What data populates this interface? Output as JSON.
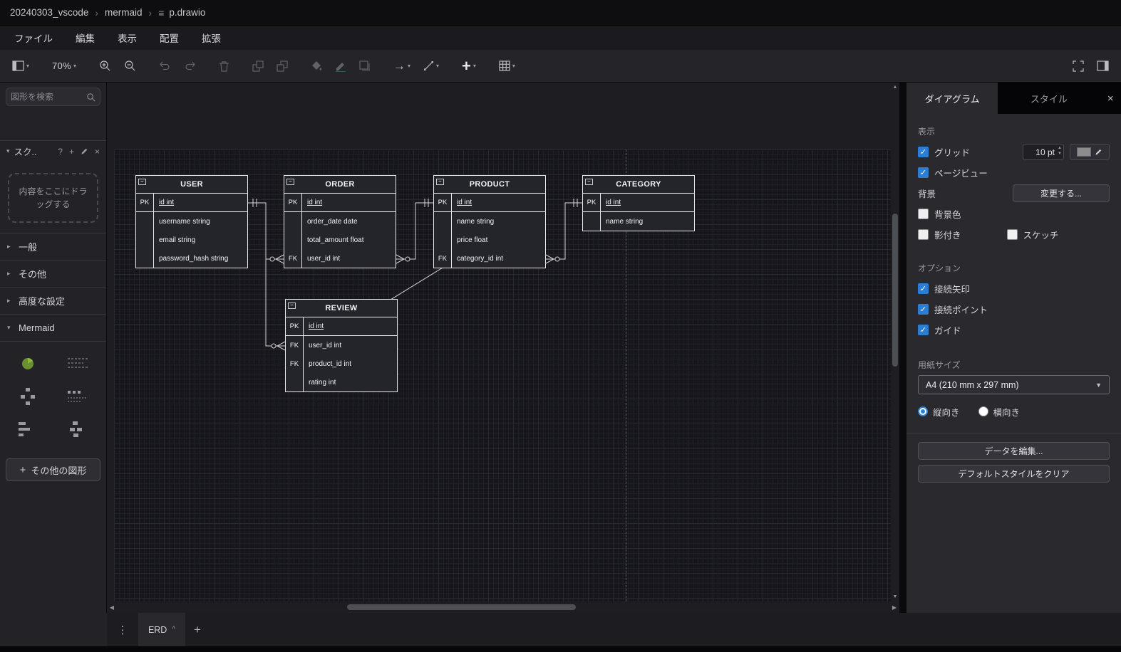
{
  "window": {
    "breadcrumb": [
      "20240303_vscode",
      "mermaid",
      "p.drawio"
    ]
  },
  "menu": {
    "items": [
      "ファイル",
      "編集",
      "表示",
      "配置",
      "拡張"
    ]
  },
  "toolbar": {
    "zoom": "70%"
  },
  "sidebar": {
    "search_placeholder": "図形を検索",
    "scratchpad": {
      "title": "スク.."
    },
    "drop_hint": "内容をここにドラッグする",
    "sections": [
      {
        "label": "一般"
      },
      {
        "label": "その他"
      },
      {
        "label": "高度な設定"
      },
      {
        "label": "Mermaid"
      }
    ],
    "more_shapes": "その他の図形"
  },
  "canvas": {
    "entities": [
      {
        "name": "USER",
        "rows": [
          {
            "k": "PK",
            "f": "id int"
          },
          {
            "k": "",
            "f": "username string"
          },
          {
            "k": "",
            "f": "email string"
          },
          {
            "k": "",
            "f": "password_hash string"
          }
        ]
      },
      {
        "name": "ORDER",
        "rows": [
          {
            "k": "PK",
            "f": "id int"
          },
          {
            "k": "",
            "f": "order_date date"
          },
          {
            "k": "",
            "f": "total_amount float"
          },
          {
            "k": "FK",
            "f": "user_id int"
          }
        ]
      },
      {
        "name": "PRODUCT",
        "rows": [
          {
            "k": "PK",
            "f": "id int"
          },
          {
            "k": "",
            "f": "name string"
          },
          {
            "k": "",
            "f": "price float"
          },
          {
            "k": "FK",
            "f": "category_id int"
          }
        ]
      },
      {
        "name": "CATEGORY",
        "rows": [
          {
            "k": "PK",
            "f": "id int"
          },
          {
            "k": "",
            "f": "name string"
          }
        ]
      },
      {
        "name": "REVIEW",
        "rows": [
          {
            "k": "PK",
            "f": "id int"
          },
          {
            "k": "FK",
            "f": "user_id int"
          },
          {
            "k": "FK",
            "f": "product_id int"
          },
          {
            "k": "",
            "f": "rating int"
          }
        ]
      }
    ]
  },
  "format_panel": {
    "tabs": {
      "diagram": "ダイアグラム",
      "style": "スタイル"
    },
    "display": {
      "title": "表示",
      "grid_label": "グリッド",
      "grid_size": "10 pt",
      "page_view_label": "ページビュー",
      "background_label": "背景",
      "change_button": "変更する...",
      "background_color_label": "背景色",
      "shadow_label": "影付き",
      "sketch_label": "スケッチ"
    },
    "options": {
      "title": "オプション",
      "items": [
        {
          "label": "接続矢印"
        },
        {
          "label": "接続ポイント"
        },
        {
          "label": "ガイド"
        }
      ]
    },
    "paper": {
      "title": "用紙サイズ",
      "size": "A4 (210 mm x 297 mm)",
      "portrait": "縦向き",
      "landscape": "横向き"
    },
    "actions": {
      "edit_data": "データを編集...",
      "clear_style": "デフォルトスタイルをクリア"
    }
  },
  "pages": {
    "active_tab": "ERD"
  }
}
